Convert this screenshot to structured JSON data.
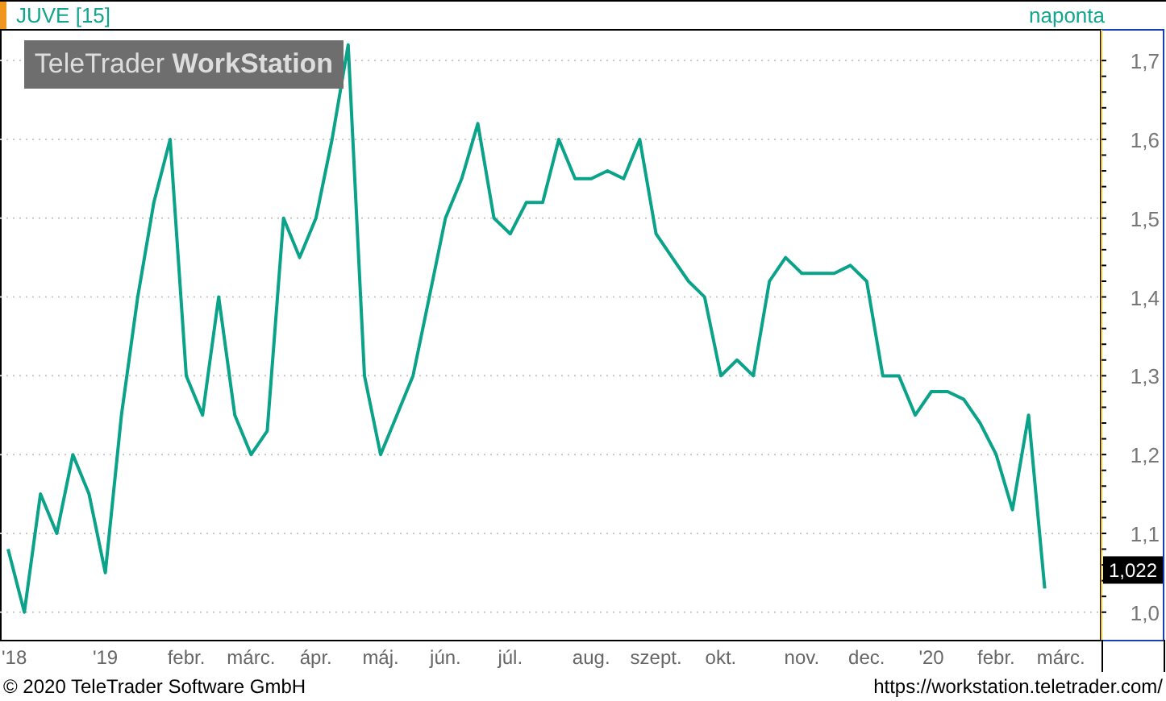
{
  "header": {
    "symbol": "JUVE [15]",
    "interval": "naponta"
  },
  "logo": {
    "text": "TeleTrader **WorkStation**"
  },
  "chart": {
    "last_price": "1,022",
    "chart_data": {
      "type": "line",
      "categories": [
        "'18",
        null,
        null,
        null,
        null,
        null,
        "'19",
        null,
        null,
        null,
        null,
        "febr.",
        null,
        null,
        null,
        "márc.",
        null,
        null,
        null,
        "ápr.",
        null,
        null,
        null,
        "máj.",
        null,
        null,
        null,
        "jún.",
        null,
        null,
        null,
        "júl.",
        null,
        null,
        null,
        null,
        "aug.",
        null,
        null,
        null,
        "szept.",
        null,
        null,
        null,
        "okt.",
        null,
        null,
        null,
        null,
        "nov.",
        null,
        null,
        null,
        "dec.",
        null,
        null,
        null,
        "'20",
        null,
        null,
        null,
        "febr.",
        null,
        null,
        null,
        "márc.",
        null,
        null
      ],
      "series": [
        {
          "color": "#0aa38a",
          "values": [
            1.08,
            1.0,
            1.15,
            1.1,
            1.2,
            1.15,
            1.05,
            1.25,
            1.4,
            1.52,
            1.6,
            1.3,
            1.25,
            1.4,
            1.25,
            1.2,
            1.23,
            1.5,
            1.45,
            1.5,
            1.6,
            1.72,
            1.3,
            1.2,
            1.25,
            1.3,
            1.4,
            1.5,
            1.55,
            1.62,
            1.5,
            1.48,
            1.52,
            1.52,
            1.6,
            1.55,
            1.55,
            1.56,
            1.55,
            1.6,
            1.48,
            1.45,
            1.42,
            1.4,
            1.3,
            1.32,
            1.3,
            1.42,
            1.45,
            1.43,
            1.43,
            1.43,
            1.44,
            1.42,
            1.3,
            1.3,
            1.25,
            1.28,
            1.28,
            1.27,
            1.24,
            1.2,
            1.13,
            1.25,
            1.03,
            null,
            null,
            null
          ]
        }
      ],
      "ylim": [
        0.965,
        1.74
      ],
      "grid": true,
      "yticks": [
        {
          "value": 1.0,
          "label": "1,0"
        },
        {
          "value": 1.1,
          "label": "1,1"
        },
        {
          "value": 1.2,
          "label": "1,2"
        },
        {
          "value": 1.3,
          "label": "1,3"
        },
        {
          "value": 1.4,
          "label": "1,4"
        },
        {
          "value": 1.5,
          "label": "1,5"
        },
        {
          "value": 1.6,
          "label": "1,6"
        },
        {
          "value": 1.7,
          "label": "1,7"
        }
      ]
    }
  },
  "footer": {
    "copyright": "© 2020 TeleTrader Software GmbH",
    "url": "https://workstation.teletrader.com/"
  }
}
